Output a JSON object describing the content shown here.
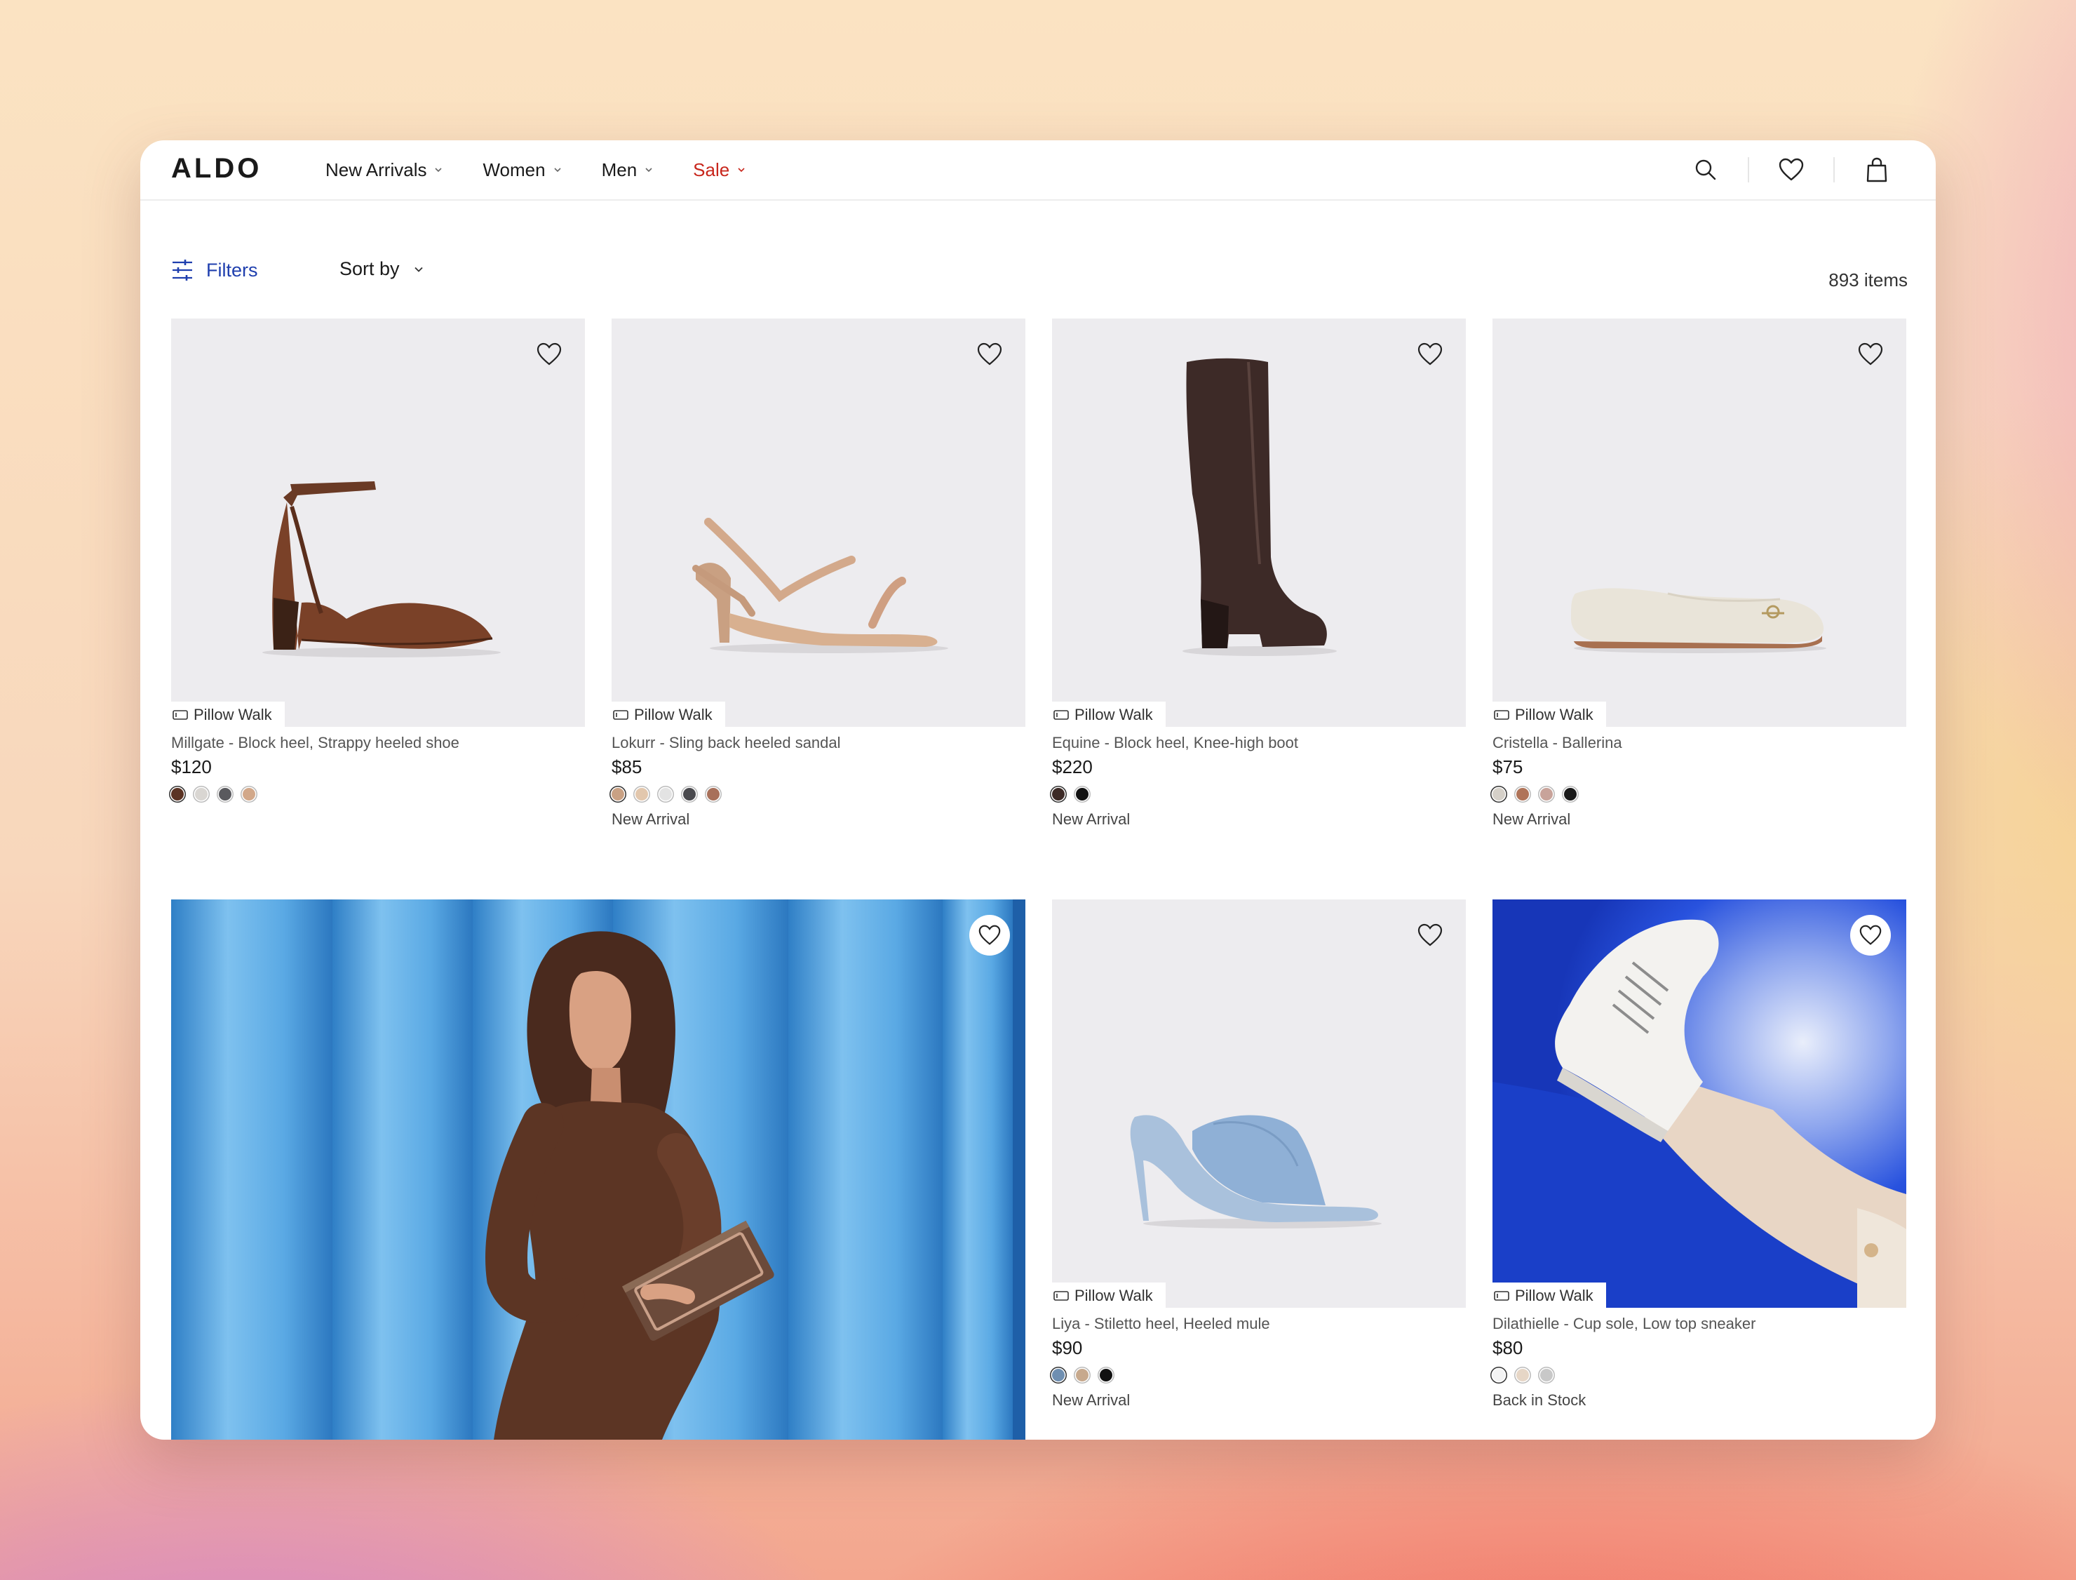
{
  "header": {
    "logo": "ALDO",
    "nav": [
      {
        "label": "New Arrivals"
      },
      {
        "label": "Women"
      },
      {
        "label": "Men"
      },
      {
        "label": "Sale"
      }
    ]
  },
  "toolbar": {
    "filters_label": "Filters",
    "sort_label": "Sort by",
    "item_count": "893 items"
  },
  "products": [
    {
      "badge": "Pillow Walk",
      "name": "Millgate - Block heel, Strappy heeled shoe",
      "price": "$120",
      "swatches": [
        "#5b3324",
        "#d9d6d2",
        "#5a5a5e",
        "#d2a88a"
      ],
      "status": ""
    },
    {
      "badge": "Pillow Walk",
      "name": "Lokurr - Sling back heeled sandal",
      "price": "$85",
      "swatches": [
        "#c9a184",
        "#e2c7ad",
        "#e3e3e3",
        "#4a4a4e",
        "#a8705a"
      ],
      "status": "New Arrival"
    },
    {
      "badge": "Pillow Walk",
      "name": "Equine - Block heel, Knee-high boot",
      "price": "$220",
      "swatches": [
        "#3c2a26",
        "#111111"
      ],
      "status": "New Arrival"
    },
    {
      "badge": "Pillow Walk",
      "name": "Cristella - Ballerina",
      "price": "$75",
      "swatches": [
        "#d5d0c8",
        "#b07459",
        "#c8a39a",
        "#1a1a1a"
      ],
      "status": "New Arrival"
    },
    {
      "badge": "Pillow Walk",
      "name": "Liya - Stiletto heel, Heeled mule",
      "price": "$90",
      "swatches": [
        "#6f8fb1",
        "#c7a98d",
        "#111111"
      ],
      "status": "New Arrival"
    },
    {
      "badge": "Pillow Walk",
      "name": "Dilathielle - Cup sole, Low top sneaker",
      "price": "$80",
      "swatches": [
        "#f3f3f3",
        "#e6d6c6",
        "#c8c8c8"
      ],
      "status": "Back in Stock"
    }
  ],
  "icons": {
    "search": "search-icon",
    "wishlist": "heart-icon",
    "bag": "bag-icon",
    "filters": "sliders-icon",
    "badge": "pillow-walk-icon"
  },
  "colors": {
    "sale": "#c8261c",
    "filters": "#1f3fae",
    "card_bg": "#edecef"
  }
}
